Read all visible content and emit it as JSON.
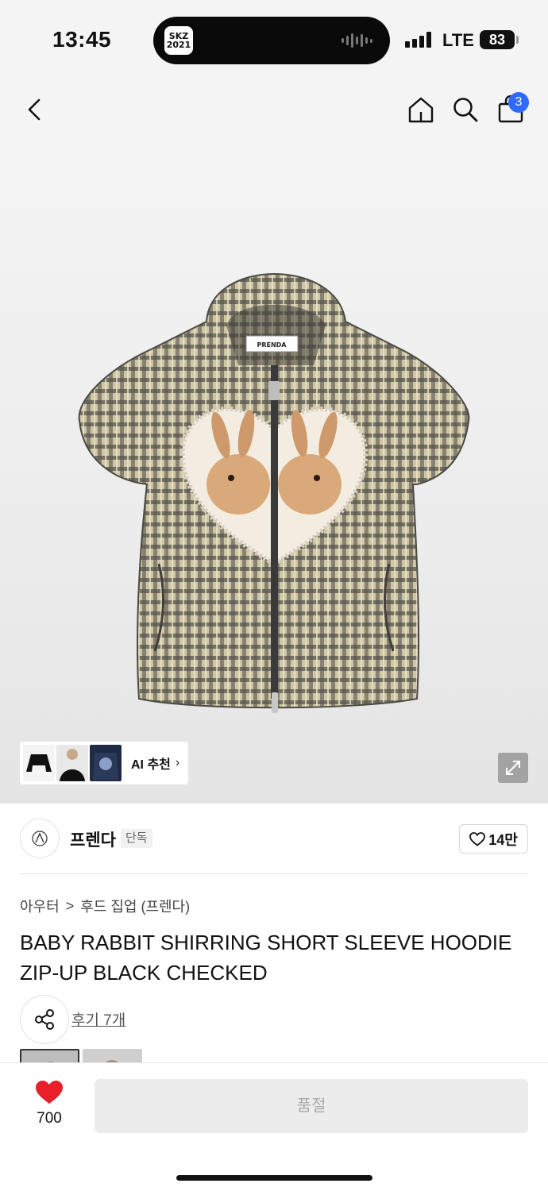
{
  "status_bar": {
    "time": "13:45",
    "island_app_label": "SKZ 2021",
    "network": "LTE",
    "battery": "83"
  },
  "nav": {
    "back_icon": "chevron-left-icon",
    "home_icon": "home-icon",
    "search_icon": "search-icon",
    "cart_icon": "shopping-bag-icon",
    "cart_badge": "3"
  },
  "product_image": {
    "ai_recommend_label": "AI 추천",
    "ai_chevron": "›",
    "expand_icon": "expand-icon",
    "garment_label": "PRENDA"
  },
  "brand": {
    "name": "프렌다",
    "badge": "단독",
    "likes": "14만"
  },
  "breadcrumb": {
    "category": "아우터",
    "separator": ">",
    "subcategory": "후드 집업 (프렌다)"
  },
  "product": {
    "title": "BABY RABBIT SHIRRING SHORT SLEEVE HOODIE ZIP-UP BLACK CHECKED",
    "reviews_link": "후기 7개"
  },
  "bottom_bar": {
    "wish_count": "700",
    "soldout_label": "품절"
  },
  "colors": {
    "accent_blue": "#2f6bff",
    "heart_red": "#e8202a",
    "soldout_bg": "#ececec"
  }
}
